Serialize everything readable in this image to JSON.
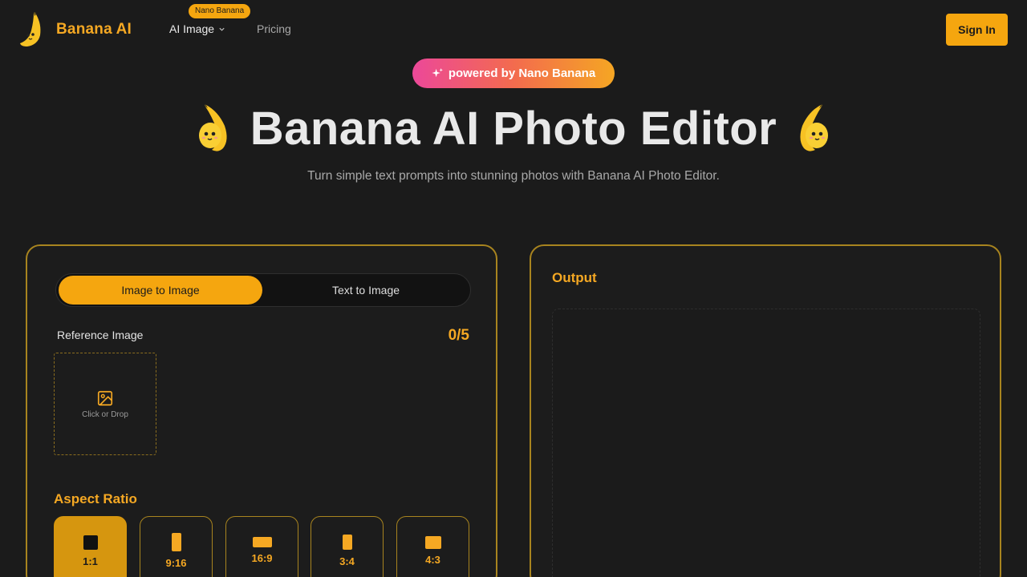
{
  "header": {
    "logo_text": "Banana AI",
    "nav": {
      "ai_image": "AI Image",
      "badge": "Nano Banana",
      "pricing": "Pricing"
    },
    "signin": "Sign In"
  },
  "hero": {
    "powered": "powered by Nano Banana",
    "title": "Banana AI Photo Editor",
    "subtitle": "Turn simple text prompts into stunning photos with Banana AI Photo Editor."
  },
  "editor": {
    "tabs": [
      "Image to Image",
      "Text to Image"
    ],
    "active_tab": "Image to Image",
    "reference_label": "Reference Image",
    "reference_count": "0/5",
    "drop_text": "Click or Drop",
    "aspect_label": "Aspect Ratio",
    "ratios": [
      "1:1",
      "9:16",
      "16:9",
      "3:4",
      "4:3"
    ],
    "selected_ratio": "1:1"
  },
  "output": {
    "title": "Output"
  },
  "colors": {
    "accent": "#f5a60f",
    "background": "#1b1b1b",
    "panel_border": "#a8841f"
  }
}
